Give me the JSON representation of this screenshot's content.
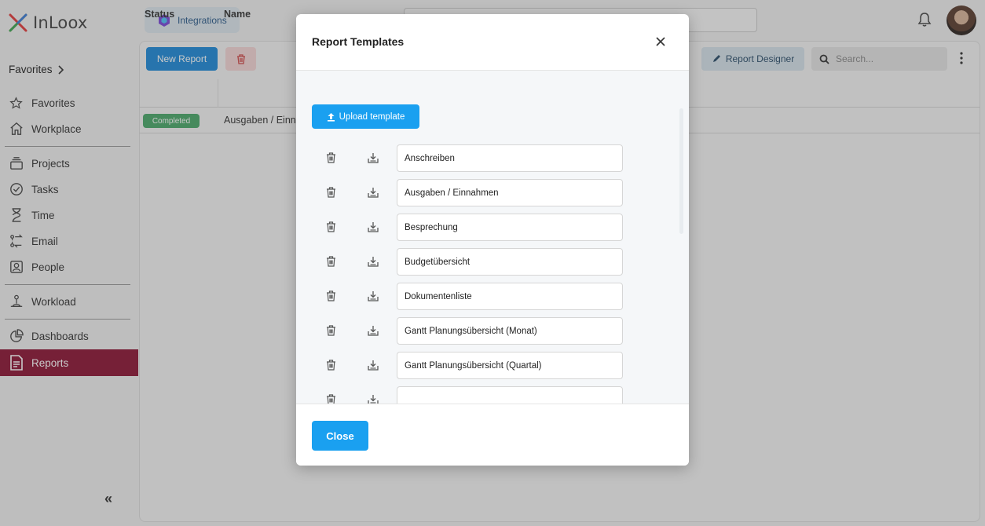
{
  "app": {
    "logo_text": "InLoox"
  },
  "header": {
    "integrations_label": "Integrations"
  },
  "sidebar": {
    "favorites_heading": "Favorites",
    "items": [
      {
        "label": "Favorites",
        "icon": "star-icon"
      },
      {
        "label": "Workplace",
        "icon": "home-icon"
      },
      {
        "label": "Projects",
        "icon": "projects-icon"
      },
      {
        "label": "Tasks",
        "icon": "check-circle-icon"
      },
      {
        "label": "Time",
        "icon": "hourglass-icon"
      },
      {
        "label": "Email",
        "icon": "email-icon"
      },
      {
        "label": "People",
        "icon": "person-icon"
      },
      {
        "label": "Workload",
        "icon": "workload-icon"
      },
      {
        "label": "Dashboards",
        "icon": "pie-chart-icon"
      },
      {
        "label": "Reports",
        "icon": "report-icon",
        "active": true
      }
    ],
    "collapse_glyph": "«"
  },
  "toolbar": {
    "new_report_label": "New Report",
    "report_designer_label": "Report Designer",
    "search_placeholder": "Search..."
  },
  "table": {
    "columns": [
      "Status",
      "Name"
    ],
    "rows": [
      {
        "status": "Completed",
        "name": "Ausgaben / Einn"
      }
    ]
  },
  "modal": {
    "title": "Report Templates",
    "upload_label": "Upload template",
    "templates": [
      "Anschreiben",
      "Ausgaben / Einnahmen",
      "Besprechung",
      "Budgetübersicht",
      "Dokumentenliste",
      "Gantt Planungsübersicht (Monat)",
      "Gantt Planungsübersicht (Quartal)",
      ""
    ],
    "close_label": "Close"
  },
  "colors": {
    "active_nav": "#8c1535",
    "primary": "#1aa0f0",
    "badge_completed": "#4aa86a"
  }
}
